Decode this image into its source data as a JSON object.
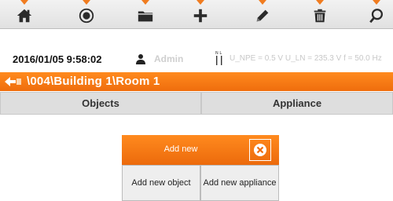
{
  "toolbar": {
    "buttons": [
      {
        "icon": "home-icon"
      },
      {
        "icon": "measure-icon"
      },
      {
        "icon": "folder-icon"
      },
      {
        "icon": "add-icon"
      },
      {
        "icon": "edit-icon"
      },
      {
        "icon": "delete-icon"
      },
      {
        "icon": "search-icon"
      }
    ],
    "marker_color": "#f07c20"
  },
  "status": {
    "datetime": "2016/01/05 9:58:02",
    "user": "Admin",
    "measurement": "U_NPE = 0.5 V U_LN = 235.3 V f = 50.0 Hz"
  },
  "path": {
    "text": "\\004\\Building 1\\Room 1"
  },
  "tabs": [
    {
      "label": "Objects"
    },
    {
      "label": "Appliance"
    }
  ],
  "dialog": {
    "title": "Add new",
    "buttons": [
      {
        "label": "Add new object"
      },
      {
        "label": "Add new appliance"
      }
    ]
  },
  "colors": {
    "accent": "#f07c20",
    "tab_bg": "#dedede"
  }
}
